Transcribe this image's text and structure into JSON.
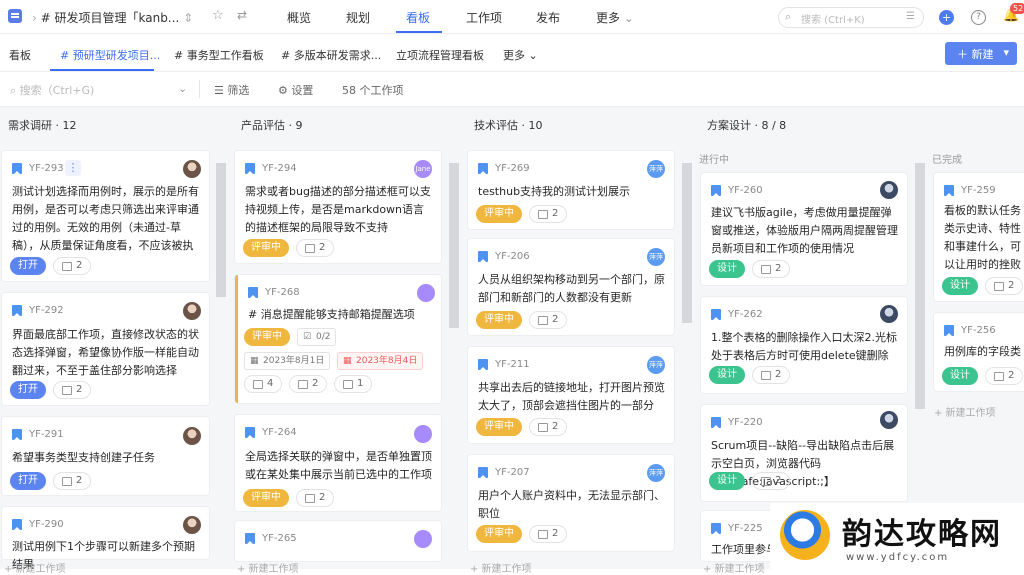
{
  "topbar": {
    "breadcrumb": "# 研发项目管理「kanb...",
    "nav": [
      "概览",
      "规划",
      "看板",
      "工作项",
      "发布",
      "更多"
    ],
    "active_nav": "看板",
    "search_placeholder": "搜索 (Ctrl+K)",
    "notification_count": "52"
  },
  "tabs": {
    "items": [
      "看板",
      "# 预研型研发项目...",
      "# 事务型工作看板",
      "# 多版本研发需求...",
      "立项流程管理看板",
      "更多"
    ],
    "new_button": "新建"
  },
  "filterbar": {
    "search_placeholder": "搜索（Ctrl+G)",
    "filter": "筛选",
    "settings": "设置",
    "count": "58 个工作项"
  },
  "columns": [
    {
      "title": "需求调研 · 12",
      "cards": [
        {
          "id": "YF-293",
          "desc": "测试计划选择而用例时，展示的是所有用例，是否可以考虑只筛选出来评审通过的用例。无效的用例（未通过-草稿），从质量保证角度看，不应该被执行",
          "tag": "打开",
          "subs": "2"
        },
        {
          "id": "YF-292",
          "desc": "界面最底部工作项，直接修改状态的状态选择弹窗，希望像协作版一样能自动翻过来，不至于盖住部分影响选择",
          "tag": "打开",
          "subs": "2"
        },
        {
          "id": "YF-291",
          "desc": "希望事务类型支持创建子任务",
          "tag": "打开",
          "subs": "2"
        },
        {
          "id": "YF-290",
          "desc": "测试用例下1个步骤可以新建多个预期结果"
        }
      ],
      "add_label": "+ 新建工作项"
    },
    {
      "title": "产品评估 · 9",
      "cards": [
        {
          "id": "YF-294",
          "desc": "需求或者bug描述的部分描述框可以支持视频上传，是否是markdown语言的描述框架的局限导致不支持",
          "tag": "评审中",
          "subs": "2",
          "avatar": "Jane"
        },
        {
          "id": "YF-268",
          "desc": "# 消息提醒能够支持邮箱提醒选项",
          "tag": "评审中",
          "progress": "0/2",
          "start": "2023年8月1日",
          "end": "2023年8月4日",
          "s1": "4",
          "s2": "2",
          "s3": "1"
        },
        {
          "id": "YF-264",
          "desc": "全局选择关联的弹窗中，是否单独置顶或在某处集中展示当前已选中的工作项",
          "tag": "评审中",
          "subs": "2"
        },
        {
          "id": "YF-265"
        }
      ],
      "add_label": "+ 新建工作项"
    },
    {
      "title": "技术评估 · 10",
      "cards": [
        {
          "id": "YF-269",
          "desc": "testhub支持我的测试计划展示",
          "tag": "评审中",
          "subs": "2",
          "avatar": "萍萍"
        },
        {
          "id": "YF-206",
          "desc": "人员从组织架构移动到另一个部门，原部门和新部门的人数都没有更新",
          "tag": "评审中",
          "subs": "2",
          "avatar": "萍萍"
        },
        {
          "id": "YF-211",
          "desc": "共享出去后的链接地址，打开图片预览太大了，顶部会遮挡住图片的一部分",
          "tag": "评审中",
          "subs": "2",
          "avatar": "萍萍"
        },
        {
          "id": "YF-207",
          "desc": "用户个人账户资料中，无法显示部门、职位",
          "tag": "评审中",
          "subs": "2",
          "avatar": "萍萍"
        }
      ],
      "add_label": "+ 新建工作项"
    },
    {
      "title": "方案设计 · 8 / 8",
      "group_progress": "进行中",
      "group_done": "已完成",
      "cards": [
        {
          "id": "YF-260",
          "desc": "建议飞书版agile，考虑做用量提醒弹窗或推送，体验版用户隔两周提醒管理员新项目和工作项的使用情况",
          "tag": "设计",
          "subs": "2"
        },
        {
          "id": "YF-262",
          "desc": "1.整个表格的删除操作入口太深2.光标处于表格后方时可使用delete键删除",
          "tag": "设计",
          "subs": "2"
        },
        {
          "id": "YF-220",
          "desc": "Scrum项目--缺陷--导出缺陷点击后展示空白页，浏览器代码【unsafe:javascript:;】",
          "tag": "设计",
          "subs": "2"
        },
        {
          "id": "YF-225",
          "desc": "工作项里参与人"
        }
      ],
      "done_cards": [
        {
          "id": "YF-259",
          "desc": "看板的默认任务类示史诗、特性和事建什么，可以让用时的挫败感",
          "tag": "设计",
          "subs": "2"
        },
        {
          "id": "YF-256",
          "desc": "用例库的字段类型",
          "tag": "设计",
          "subs": "2"
        }
      ],
      "add_label": "+ 新建工作项"
    }
  ],
  "watermark": {
    "title": "韵达攻略网",
    "url": "www.ydfcy.com"
  }
}
